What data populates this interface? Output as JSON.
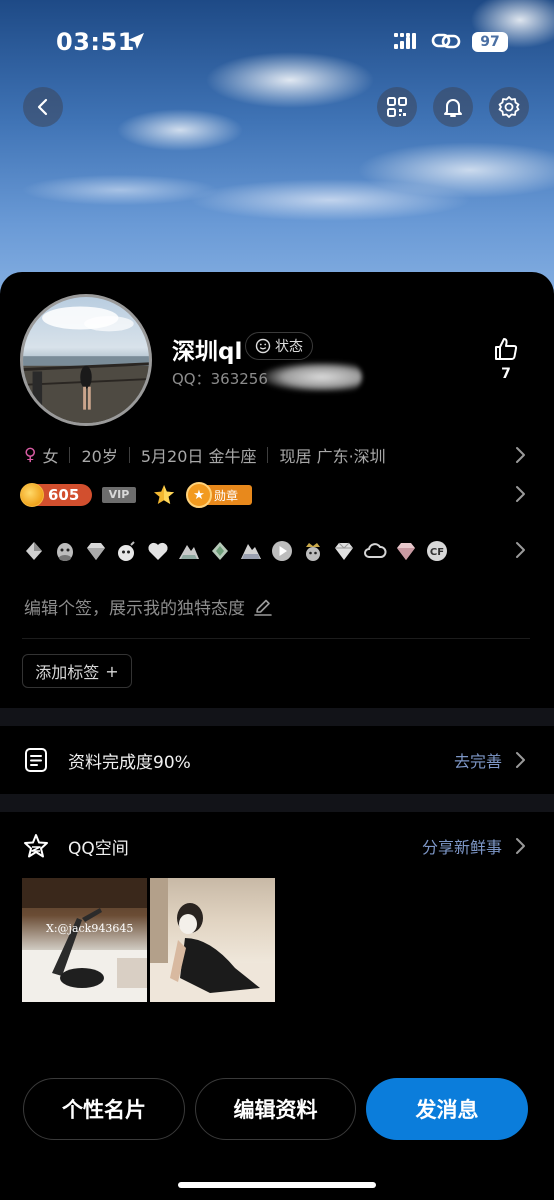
{
  "status_bar": {
    "time": "03:51",
    "battery": "97"
  },
  "profile": {
    "nickname": "深圳ql",
    "status_label": "状态",
    "qq_number": "QQ：363256",
    "like_count": "7",
    "gender": "女",
    "age": "20岁",
    "birthday": "5月20日 金牛座",
    "location": "现居 广东·深圳",
    "coin_count": "605",
    "vip_label": "VIP",
    "medal_label": "勋章",
    "signature_placeholder": "编辑个签，展示我的独特态度",
    "add_tag_label": "添加标签",
    "add_tag_plus": "+"
  },
  "profile_completion": {
    "label": "资料完成度90%",
    "action": "去完善"
  },
  "qzone": {
    "label": "QQ空间",
    "action": "分享新鲜事",
    "photo_watermark": "X:@jack943645"
  },
  "bottom_actions": {
    "card": "个性名片",
    "edit": "编辑资料",
    "message": "发消息"
  },
  "colors": {
    "accent": "#0b7ddb",
    "link": "#7d96c6",
    "female": "#d95ca4",
    "coin": "#d24f2e",
    "medal": "#e8891c"
  },
  "icons": {
    "header": [
      "back-icon",
      "qr-code-icon",
      "bell-icon",
      "gear-icon"
    ],
    "badges": [
      "crown-icon",
      "qq-penguin-icon",
      "diamond-icon",
      "bomb-icon",
      "heart-icon",
      "mountain-icon",
      "green-gem-icon",
      "mountain-icon",
      "play-icon",
      "penguin-crown-icon",
      "diamond-icon",
      "cloud-icon",
      "pink-gem-icon",
      "cf-icon"
    ]
  }
}
